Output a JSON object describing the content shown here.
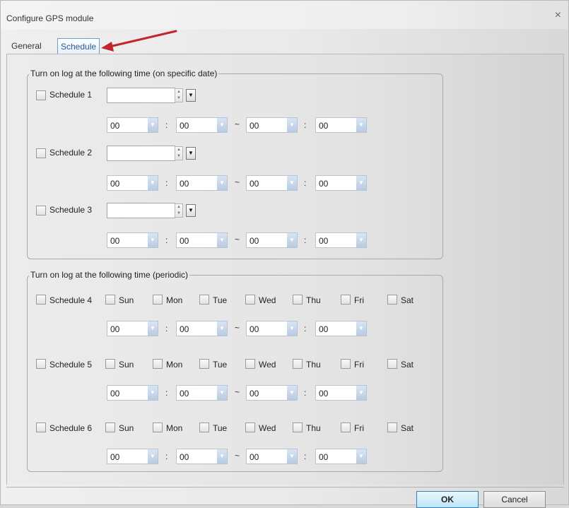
{
  "window": {
    "title": "Configure GPS module",
    "close_glyph": "×"
  },
  "tabs": [
    {
      "label": "General",
      "active": false
    },
    {
      "label": "Schedule",
      "active": true
    }
  ],
  "accent_color": "#c0262b",
  "group_specific": {
    "legend": "Turn on log at the following time (on specific date)",
    "schedules": [
      {
        "label": "Schedule 1",
        "checked": false,
        "date": "",
        "start_hour": "00",
        "start_min": "00",
        "end_hour": "00",
        "end_min": "00"
      },
      {
        "label": "Schedule 2",
        "checked": false,
        "date": "",
        "start_hour": "00",
        "start_min": "00",
        "end_hour": "00",
        "end_min": "00"
      },
      {
        "label": "Schedule 3",
        "checked": false,
        "date": "",
        "start_hour": "00",
        "start_min": "00",
        "end_hour": "00",
        "end_min": "00"
      }
    ]
  },
  "group_periodic": {
    "legend": "Turn on log at the following time (periodic)",
    "days": [
      "Sun",
      "Mon",
      "Tue",
      "Wed",
      "Thu",
      "Fri",
      "Sat"
    ],
    "schedules": [
      {
        "label": "Schedule 4",
        "checked": false,
        "start_hour": "00",
        "start_min": "00",
        "end_hour": "00",
        "end_min": "00"
      },
      {
        "label": "Schedule 5",
        "checked": false,
        "start_hour": "00",
        "start_min": "00",
        "end_hour": "00",
        "end_min": "00"
      },
      {
        "label": "Schedule 6",
        "checked": false,
        "start_hour": "00",
        "start_min": "00",
        "end_hour": "00",
        "end_min": "00"
      }
    ]
  },
  "time_separators": {
    "colon": ":",
    "range": "~"
  },
  "icons": {
    "spin_up": "▲",
    "spin_down": "▼",
    "dropdown": "▼"
  },
  "buttons": {
    "ok": "OK",
    "cancel": "Cancel"
  }
}
